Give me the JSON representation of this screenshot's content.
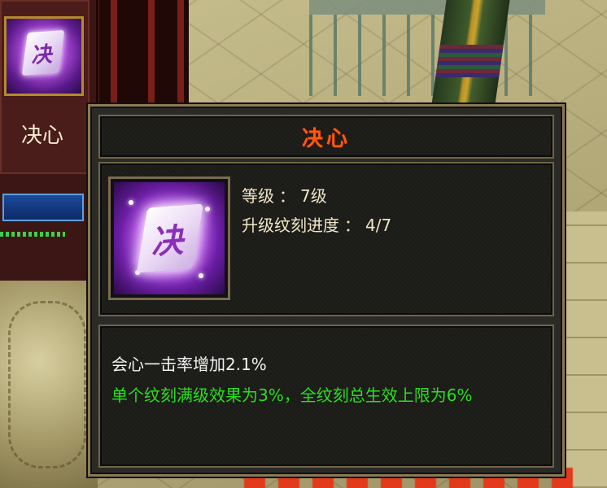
{
  "skillbar": {
    "slot_label": "决心",
    "icon": "jue-xin-skill-icon",
    "icon_glyph": "决"
  },
  "tooltip": {
    "title": "决心",
    "icon": "jue-xin-skill-icon",
    "icon_glyph": "决",
    "level_label": "等级",
    "level_value": "7级",
    "progress_label": "升级纹刻进度",
    "progress_value": "4/7",
    "colon": "：",
    "effect_text": "会心一击率增加2.1%",
    "note_text": "单个纹刻满级效果为3%，全纹刻总生效上限为6%"
  },
  "colors": {
    "title": "#ff5a12",
    "effect_text": "#f3f3f3",
    "note_text": "#28e01c",
    "info_text": "#f1e6c6"
  }
}
